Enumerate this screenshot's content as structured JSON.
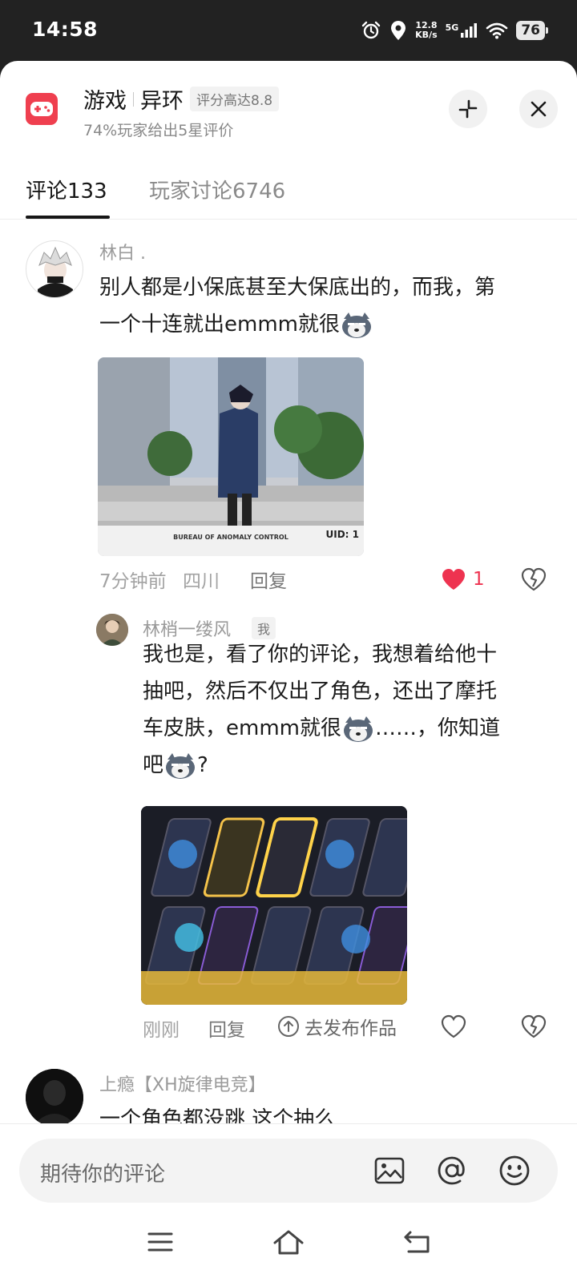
{
  "status_bar": {
    "time": "14:58",
    "net_speed": "12.8",
    "net_speed_unit": "KB/s",
    "network": "5G",
    "battery": "76"
  },
  "game": {
    "category": "游戏",
    "name": "异环",
    "rating_badge": "评分高达8.8",
    "subtitle": "74%玩家给出5星评价",
    "icon_color": "#ef3f4f"
  },
  "tabs": [
    {
      "label": "评论",
      "count": "133"
    },
    {
      "label": "玩家讨论",
      "count": "6746"
    }
  ],
  "comments": [
    {
      "username": "林白 .",
      "text_line1": "别人都是小保底甚至大保底出的，而我，第",
      "text_line2": "一个十连就出emmm就很",
      "image_caption": "BUREAU OF ANOMALY CONTROL",
      "image_uid": "UID: 1",
      "time": "7分钟前",
      "location": "四川",
      "reply": "回复",
      "likes": "1",
      "liked": true,
      "reply_item": {
        "username": "林梢一缕风",
        "badge": "我",
        "text_line1": "我也是，看了你的评论，我想着给他十",
        "text_line2": "抽吧，然后不仅出了角色，还出了摩托",
        "text_line3a": "车皮肤，emmm就很",
        "text_line3b": "……，你知道",
        "text_line4a": "吧",
        "text_line4b": "?",
        "time": "刚刚",
        "reply": "回复",
        "publish": "去发布作品"
      }
    },
    {
      "username": "上瘾【XH旋律电竞】",
      "text_line1": "一个角色都没跳 这个抽么"
    }
  ],
  "input": {
    "placeholder": "期待你的评论"
  },
  "colors": {
    "like_red": "#ee3350",
    "background_dark": "#222222"
  }
}
